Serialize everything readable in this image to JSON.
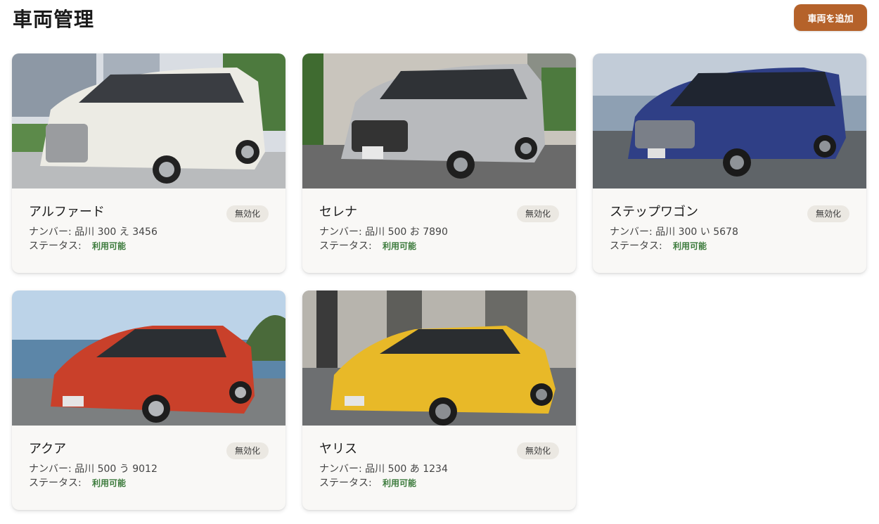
{
  "header": {
    "title": "車両管理",
    "add_button_label": "車両を追加"
  },
  "vehicles": [
    {
      "name": "アルファード",
      "plate_label": "ナンバー:",
      "plate": "品川 300 え 3456",
      "status_label": "ステータス:",
      "status": "利用可能",
      "badge": "無効化"
    },
    {
      "name": "セレナ",
      "plate_label": "ナンバー:",
      "plate": "品川 500 お 7890",
      "status_label": "ステータス:",
      "status": "利用可能",
      "badge": "無効化"
    },
    {
      "name": "ステップワゴン",
      "plate_label": "ナンバー:",
      "plate": "品川 300 い 5678",
      "status_label": "ステータス:",
      "status": "利用可能",
      "badge": "無効化"
    },
    {
      "name": "アクア",
      "plate_label": "ナンバー:",
      "plate": "品川 500 う 9012",
      "status_label": "ステータス:",
      "status": "利用可能",
      "badge": "無効化"
    },
    {
      "name": "ヤリス",
      "plate_label": "ナンバー:",
      "plate": "品川 500 あ 1234",
      "status_label": "ステータス:",
      "status": "利用可能",
      "badge": "無効化"
    }
  ],
  "colors": {
    "accent": "#b5622a",
    "status_ok": "#3b7a3b"
  }
}
